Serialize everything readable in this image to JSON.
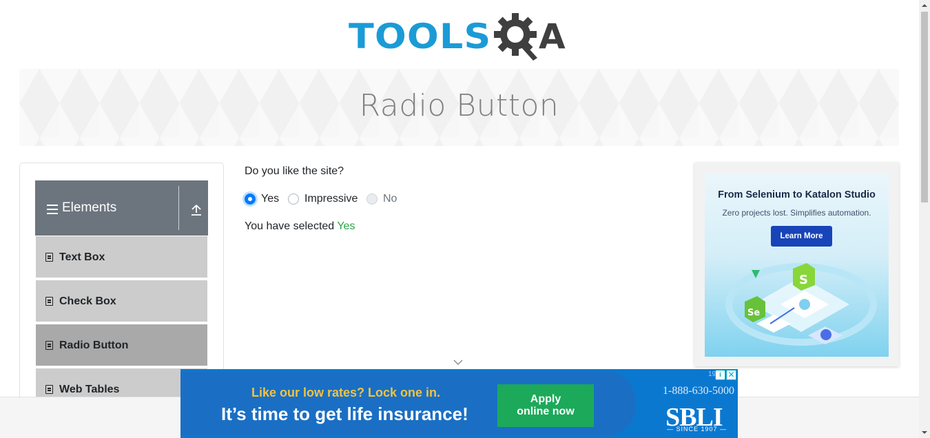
{
  "header": {
    "logo_text": "TOOLS",
    "logo_suffix": "A"
  },
  "banner": {
    "title": "Radio Button"
  },
  "sidebar": {
    "group_title": "Elements",
    "items": [
      {
        "label": "Text Box",
        "active": false
      },
      {
        "label": "Check Box",
        "active": false
      },
      {
        "label": "Radio Button",
        "active": true
      },
      {
        "label": "Web Tables",
        "active": false
      }
    ]
  },
  "main": {
    "question": "Do you like the site?",
    "options": [
      {
        "label": "Yes",
        "checked": true,
        "disabled": false
      },
      {
        "label": "Impressive",
        "checked": false,
        "disabled": false
      },
      {
        "label": "No",
        "checked": false,
        "disabled": true
      }
    ],
    "result_prefix": "You have selected ",
    "result_value": "Yes"
  },
  "ad_right": {
    "title": "From Selenium to Katalon Studio",
    "subtitle": "Zero projects lost. Simplifies automation.",
    "button": "Learn More",
    "badge_s": "S",
    "badge_se": "Se"
  },
  "ad_bottom": {
    "headline1": "Like our low rates? Lock one in.",
    "headline2": "It’s time to get life insurance!",
    "apply_line1": "Apply",
    "apply_line2": "online now",
    "phone": "1-888-630-5000",
    "brand": "SBLI",
    "since": "— SINCE 1907 —",
    "corner_num": "19",
    "info_symbol": "i",
    "close_symbol": "✕"
  },
  "colors": {
    "accent": "#007bff",
    "success": "#28a745",
    "group_header": "#6c757d",
    "menu_item": "#cccccc",
    "menu_item_active": "#a9a9a9"
  }
}
